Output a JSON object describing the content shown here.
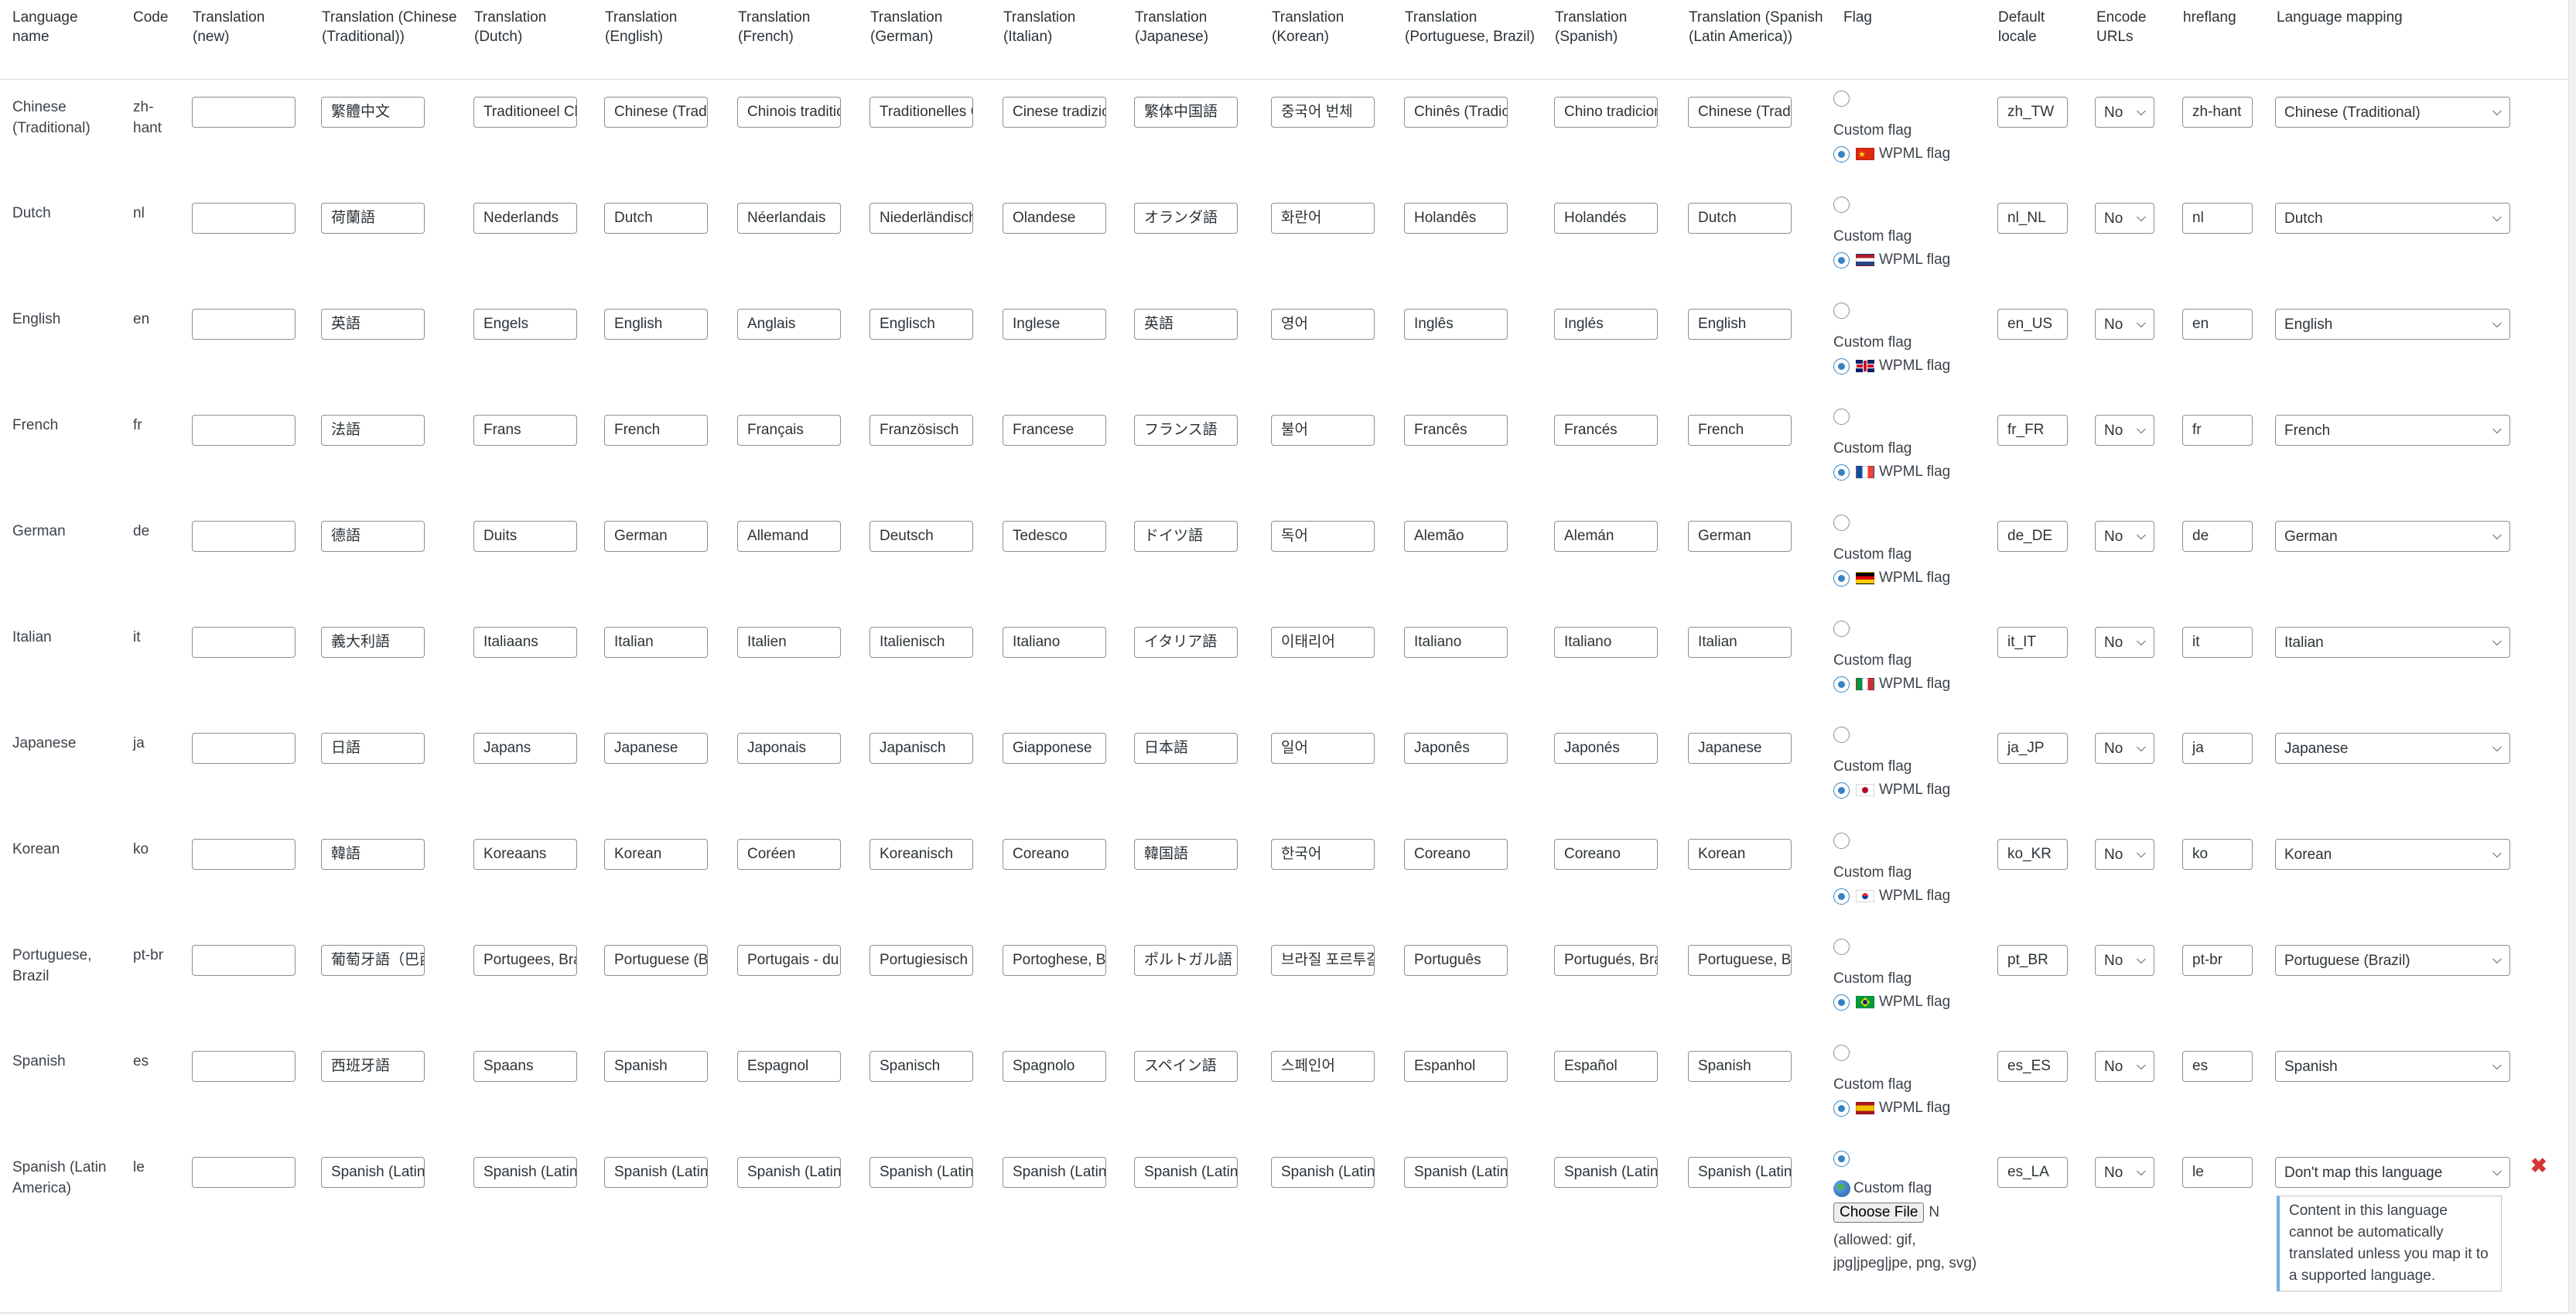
{
  "headers": [
    "Language name",
    "Code",
    "Translation (new)",
    "Translation (Chinese (Traditional))",
    "Translation (Dutch)",
    "Translation (English)",
    "Translation (French)",
    "Translation (German)",
    "Translation (Italian)",
    "Translation (Japanese)",
    "Translation (Korean)",
    "Translation (Portuguese, Brazil)",
    "Translation (Spanish)",
    "Translation (Spanish (Latin America))",
    "Flag",
    "Default locale",
    "Encode URLs",
    "hreflang",
    "Language mapping"
  ],
  "flag_labels": {
    "custom": "Custom flag",
    "wpml": "WPML flag",
    "choose_file": "Choose File",
    "no_file": "N",
    "allowed": "(allowed: gif, jpg|jpeg|jpe, png, svg)"
  },
  "rows": [
    {
      "name": "Chinese (Traditional)",
      "code": "zh-hant",
      "new": "",
      "t": [
        "繁體中文",
        "Traditioneel Chinees",
        "Chinese (Traditional)",
        "Chinois traditionnel",
        "Traditionelles Chinesisch",
        "Cinese tradizionale",
        "繁体中国語",
        "중국어 번체",
        "Chinês (Tradicional)",
        "Chino tradicional",
        "Chinese (Traditional)"
      ],
      "flag": "cn",
      "locale": "zh_TW",
      "encode": "No",
      "hreflang": "zh-hant",
      "mapping": "Chinese (Traditional)"
    },
    {
      "name": "Dutch",
      "code": "nl",
      "new": "",
      "t": [
        "荷蘭語",
        "Nederlands",
        "Dutch",
        "Néerlandais",
        "Niederländisch",
        "Olandese",
        "オランダ語",
        "화란어",
        "Holandês",
        "Holandés",
        "Dutch"
      ],
      "flag": "nl",
      "locale": "nl_NL",
      "encode": "No",
      "hreflang": "nl",
      "mapping": "Dutch"
    },
    {
      "name": "English",
      "code": "en",
      "new": "",
      "t": [
        "英語",
        "Engels",
        "English",
        "Anglais",
        "Englisch",
        "Inglese",
        "英語",
        "영어",
        "Inglês",
        "Inglés",
        "English"
      ],
      "flag": "gb",
      "locale": "en_US",
      "encode": "No",
      "hreflang": "en",
      "mapping": "English"
    },
    {
      "name": "French",
      "code": "fr",
      "new": "",
      "t": [
        "法語",
        "Frans",
        "French",
        "Français",
        "Französisch",
        "Francese",
        "フランス語",
        "불어",
        "Francês",
        "Francés",
        "French"
      ],
      "flag": "fr",
      "locale": "fr_FR",
      "encode": "No",
      "hreflang": "fr",
      "mapping": "French"
    },
    {
      "name": "German",
      "code": "de",
      "new": "",
      "t": [
        "德語",
        "Duits",
        "German",
        "Allemand",
        "Deutsch",
        "Tedesco",
        "ドイツ語",
        "독어",
        "Alemão",
        "Alemán",
        "German"
      ],
      "flag": "de",
      "locale": "de_DE",
      "encode": "No",
      "hreflang": "de",
      "mapping": "German"
    },
    {
      "name": "Italian",
      "code": "it",
      "new": "",
      "t": [
        "義大利語",
        "Italiaans",
        "Italian",
        "Italien",
        "Italienisch",
        "Italiano",
        "イタリア語",
        "이태리어",
        "Italiano",
        "Italiano",
        "Italian"
      ],
      "flag": "it",
      "locale": "it_IT",
      "encode": "No",
      "hreflang": "it",
      "mapping": "Italian"
    },
    {
      "name": "Japanese",
      "code": "ja",
      "new": "",
      "t": [
        "日語",
        "Japans",
        "Japanese",
        "Japonais",
        "Japanisch",
        "Giapponese",
        "日本語",
        "일어",
        "Japonês",
        "Japonés",
        "Japanese"
      ],
      "flag": "jp",
      "locale": "ja_JP",
      "encode": "No",
      "hreflang": "ja",
      "mapping": "Japanese"
    },
    {
      "name": "Korean",
      "code": "ko",
      "new": "",
      "t": [
        "韓語",
        "Koreaans",
        "Korean",
        "Coréen",
        "Koreanisch",
        "Coreano",
        "韓国語",
        "한국어",
        "Coreano",
        "Coreano",
        "Korean"
      ],
      "flag": "kr",
      "locale": "ko_KR",
      "encode": "No",
      "hreflang": "ko",
      "mapping": "Korean"
    },
    {
      "name": "Portuguese, Brazil",
      "code": "pt-br",
      "new": "",
      "t": [
        "葡萄牙語（巴西）",
        "Portugees, Braziliaans",
        "Portuguese (Brazil)",
        "Portugais - du Brésil",
        "Portugiesisch (Brasilien)",
        "Portoghese, Brasile",
        "ポルトガル語（ブラジル）",
        "브라질 포르투갈어",
        "Português",
        "Portugués, Brasil",
        "Portuguese, Brazil"
      ],
      "flag": "br",
      "locale": "pt_BR",
      "encode": "No",
      "hreflang": "pt-br",
      "mapping": "Portuguese (Brazil)"
    },
    {
      "name": "Spanish",
      "code": "es",
      "new": "",
      "t": [
        "西班牙語",
        "Spaans",
        "Spanish",
        "Espagnol",
        "Spanisch",
        "Spagnolo",
        "スペイン語",
        "스페인어",
        "Espanhol",
        "Español",
        "Spanish"
      ],
      "flag": "es",
      "locale": "es_ES",
      "encode": "No",
      "hreflang": "es",
      "mapping": "Spanish"
    },
    {
      "name": "Spanish (Latin America)",
      "code": "le",
      "new": "",
      "t": [
        "Spanish (Latin America)",
        "Spanish (Latin America)",
        "Spanish (Latin America)",
        "Spanish (Latin America)",
        "Spanish (Latin America)",
        "Spanish (Latin America)",
        "Spanish (Latin America)",
        "Spanish (Latin America)",
        "Spanish (Latin America)",
        "Spanish (Latin America)",
        "Spanish (Latin America)"
      ],
      "flag": "custom",
      "locale": "es_LA",
      "encode": "No",
      "hreflang": "le",
      "mapping": "Don't map this language",
      "notice": "Content in this language cannot be automatically translated unless you map it to a supported language."
    }
  ]
}
